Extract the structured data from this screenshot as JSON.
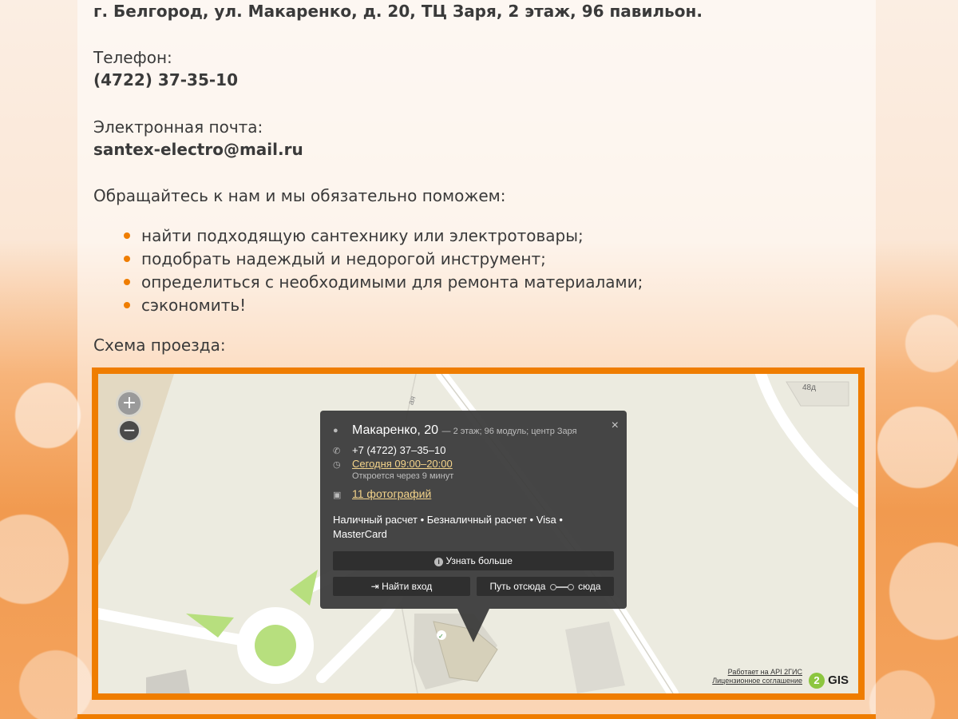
{
  "contacts": {
    "address": "г. Белгород, ул. Макаренко, д. 20, ТЦ Заря, 2 этаж, 96 павильон.",
    "phone_label": "Телефон:",
    "phone": "(4722) 37-35-10",
    "email_label": "Электронная почта:",
    "email": "santex-electro@mail.ru"
  },
  "intro": "Обращайтесь к нам и мы обязательно поможем:",
  "bullets": [
    "найти подходящую сантехнику или электротовары;",
    "подобрать надеждый и недорогой инструмент;",
    "определиться с необходимыми для ремонта материалами;",
    "сэкономить!"
  ],
  "route_label": "Схема проезда:",
  "map": {
    "zoom_in": "+",
    "zoom_out": "−",
    "house_48d": "48д",
    "street_label": "ая",
    "popup": {
      "title": "Макаренко, 20",
      "subtitle": "— 2 этаж; 96 модуль; центр Заря",
      "phone": "+7 (4722) 37–35–10",
      "hours": "Сегодня 09:00–20:00",
      "opens_in": "Откроется через 9 минут",
      "photos": "11 фотографий",
      "payment": "Наличный расчет • Безналичный расчет • Visa • MasterCard",
      "more_button": "Узнать больше",
      "entrance_button": "Найти вход",
      "route_from": "Путь отсюда",
      "route_to": "сюда",
      "close": "×"
    },
    "attribution_line1": "Работает на API 2ГИС",
    "attribution_line2": "Лицензионное соглашение",
    "logo_number": "2",
    "logo_text": "GIS"
  },
  "colors": {
    "accent": "#ef7d00",
    "link_yellow": "#f3d38a",
    "popup_bg": "#3a3a3a",
    "park_green": "#b7df7e"
  }
}
